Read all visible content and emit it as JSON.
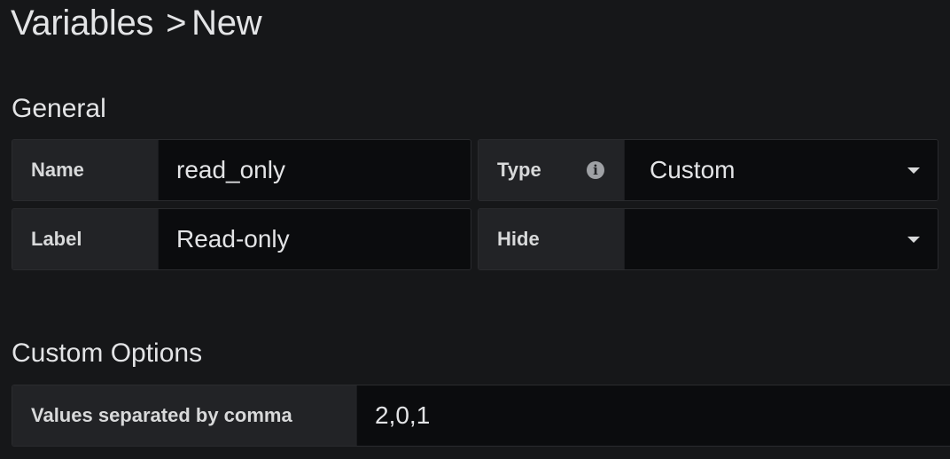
{
  "header": {
    "breadcrumb_parent": "Variables",
    "breadcrumb_separator": ">",
    "breadcrumb_current": "New"
  },
  "general": {
    "heading": "General",
    "name": {
      "label": "Name",
      "value": "read_only"
    },
    "type": {
      "label": "Type",
      "info_icon": "info-circle-icon",
      "value": "Custom"
    },
    "label": {
      "label": "Label",
      "value": "Read-only"
    },
    "hide": {
      "label": "Hide",
      "value": ""
    }
  },
  "custom_options": {
    "heading": "Custom Options",
    "values": {
      "label": "Values separated by comma",
      "value": "2,0,1"
    }
  },
  "colors": {
    "background": "#161719",
    "label_bg": "#222326",
    "input_bg": "#0b0c0e",
    "text": "#d8d9da"
  }
}
